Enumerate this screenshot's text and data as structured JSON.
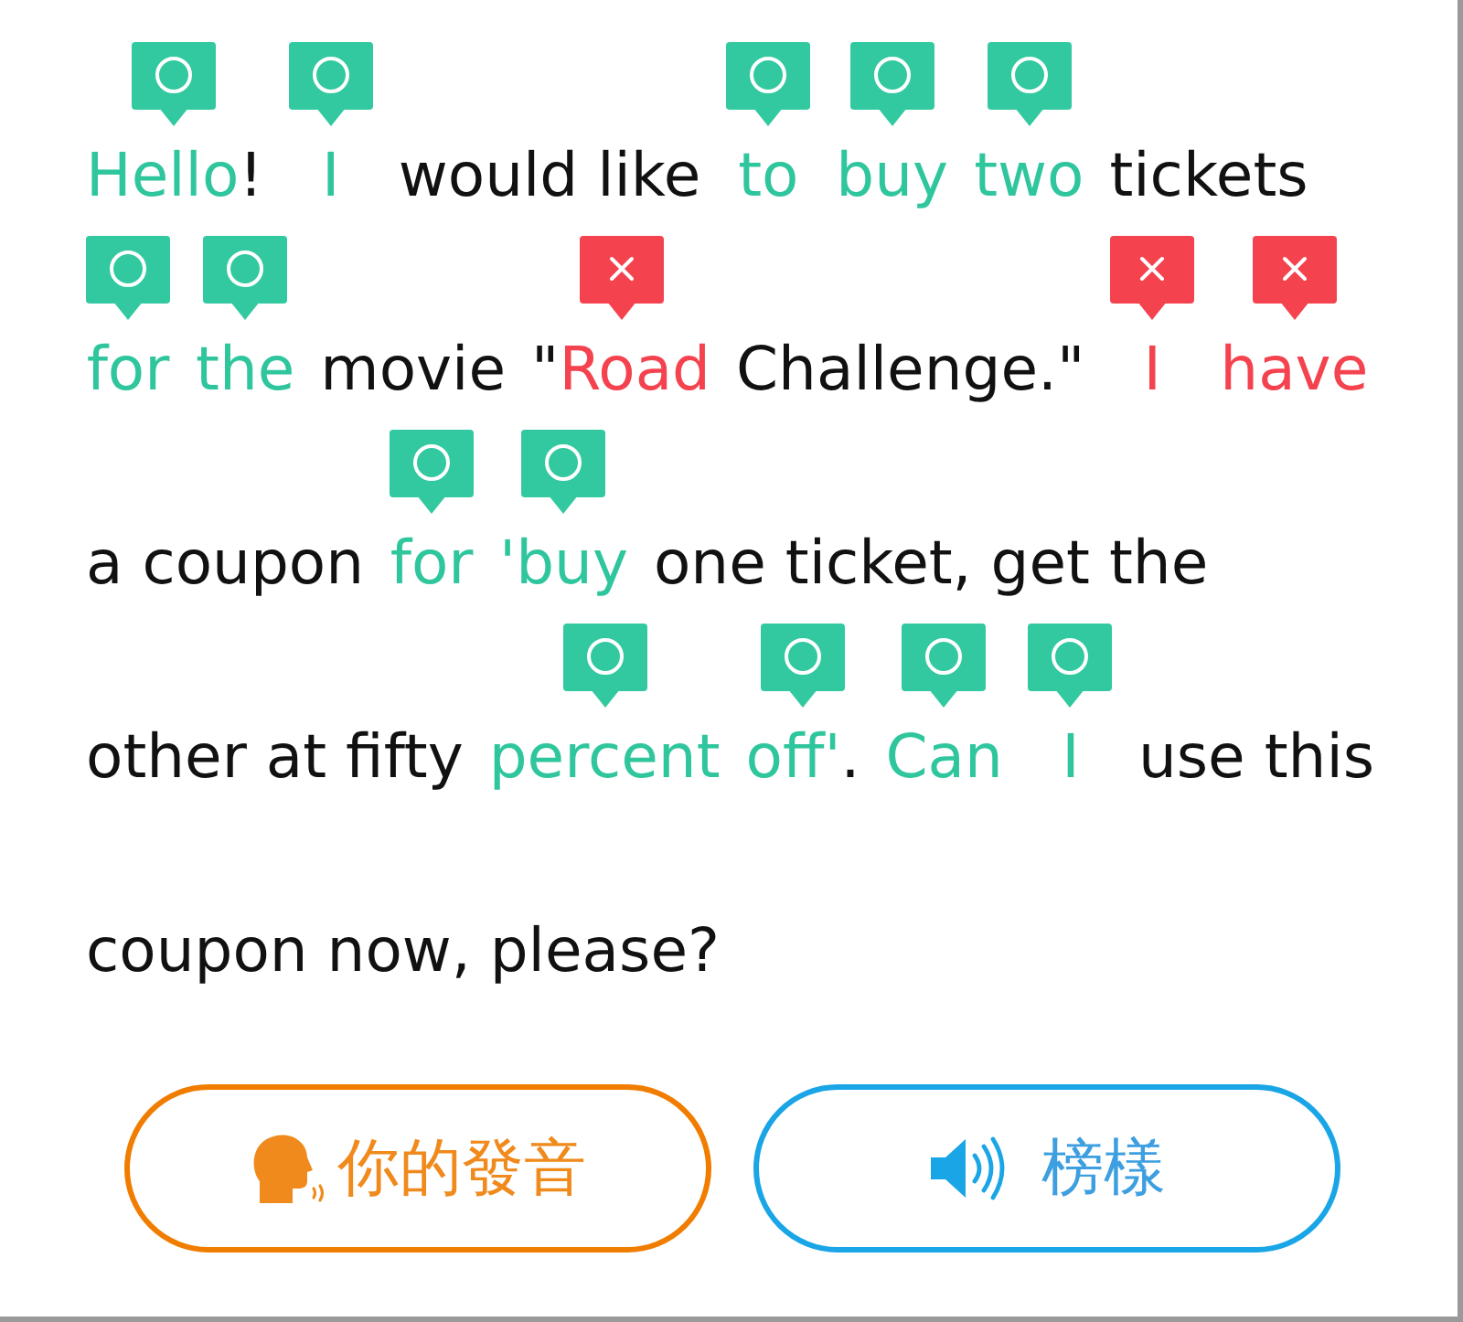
{
  "passage": {
    "lines": [
      {
        "words": [
          {
            "text": "Hello",
            "kind": "correct",
            "suffix": "!"
          },
          {
            "text": "I",
            "kind": "correct"
          },
          {
            "text": "would like",
            "kind": "plain"
          },
          {
            "text": "to",
            "kind": "correct"
          },
          {
            "text": "buy",
            "kind": "correct"
          },
          {
            "text": "two",
            "kind": "correct"
          },
          {
            "text": "tickets",
            "kind": "plain"
          }
        ]
      },
      {
        "words": [
          {
            "text": "for",
            "kind": "correct"
          },
          {
            "text": "the",
            "kind": "correct"
          },
          {
            "text": "movie",
            "kind": "plain"
          },
          {
            "prefix": "\"",
            "text": "Road",
            "kind": "wrong"
          },
          {
            "text": "Challenge.\"",
            "kind": "plain"
          },
          {
            "text": "I",
            "kind": "wrong"
          },
          {
            "text": "have",
            "kind": "wrong"
          }
        ]
      },
      {
        "words": [
          {
            "text": "a coupon",
            "kind": "plain"
          },
          {
            "text": "for",
            "kind": "correct"
          },
          {
            "text": "'buy",
            "kind": "correct"
          },
          {
            "text": "one ticket, get the",
            "kind": "plain"
          }
        ]
      },
      {
        "words": [
          {
            "text": "other at fifty",
            "kind": "plain"
          },
          {
            "text": "percent",
            "kind": "correct"
          },
          {
            "text": "off'",
            "kind": "correct",
            "suffix": "."
          },
          {
            "text": "Can",
            "kind": "correct"
          },
          {
            "text": "I",
            "kind": "correct"
          },
          {
            "text": "use this",
            "kind": "plain"
          }
        ]
      },
      {
        "words": [
          {
            "text": "coupon now, please?",
            "kind": "plain"
          }
        ]
      }
    ]
  },
  "buttons": [
    {
      "kind": "record",
      "label": "你的發音"
    },
    {
      "kind": "play",
      "label": "榜樣"
    }
  ]
}
